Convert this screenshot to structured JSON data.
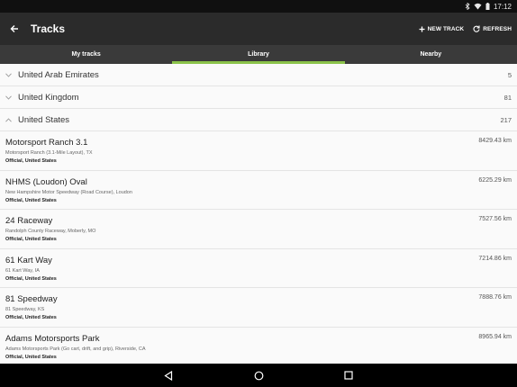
{
  "status_bar": {
    "time": "17:12"
  },
  "app_bar": {
    "title": "Tracks",
    "actions": [
      {
        "label": "NEW TRACK",
        "icon": "plus-icon"
      },
      {
        "label": "REFRESH",
        "icon": "refresh-icon"
      }
    ]
  },
  "tabs": [
    {
      "label": "My tracks",
      "active": false
    },
    {
      "label": "Library",
      "active": true
    },
    {
      "label": "Nearby",
      "active": false
    }
  ],
  "countries": [
    {
      "name": "United Arab Emirates",
      "count": "5",
      "expanded": false
    },
    {
      "name": "United Kingdom",
      "count": "81",
      "expanded": false
    },
    {
      "name": "United States",
      "count": "217",
      "expanded": true
    }
  ],
  "tracks": [
    {
      "name": "Motorsport Ranch 3.1",
      "subtitle": "Motorsport Ranch (3.1-Mile Layout), TX",
      "category": "Official, United States",
      "distance": "8429.43 km"
    },
    {
      "name": "NHMS (Loudon) Oval",
      "subtitle": "New Hampshire Motor Speedway (Road Course), Loudon",
      "category": "Official, United States",
      "distance": "6225.29 km"
    },
    {
      "name": "24 Raceway",
      "subtitle": "Randolph County Raceway, Moberly, MO",
      "category": "Official, United States",
      "distance": "7527.56 km"
    },
    {
      "name": "61 Kart Way",
      "subtitle": "61 Kart Way, IA",
      "category": "Official, United States",
      "distance": "7214.86 km"
    },
    {
      "name": "81 Speedway",
      "subtitle": "81 Speedway, KS",
      "category": "Official, United States",
      "distance": "7888.76 km"
    },
    {
      "name": "Adams Motorsports Park",
      "subtitle": "Adams Motorsports Park (Go cart, drift, and grip), Riverside, CA",
      "category": "Official, United States",
      "distance": "8965.94 km"
    }
  ],
  "colors": {
    "accent": "#8bc34a",
    "app_bar": "#2b2b2b",
    "tab_bar": "#3a3a3a"
  }
}
